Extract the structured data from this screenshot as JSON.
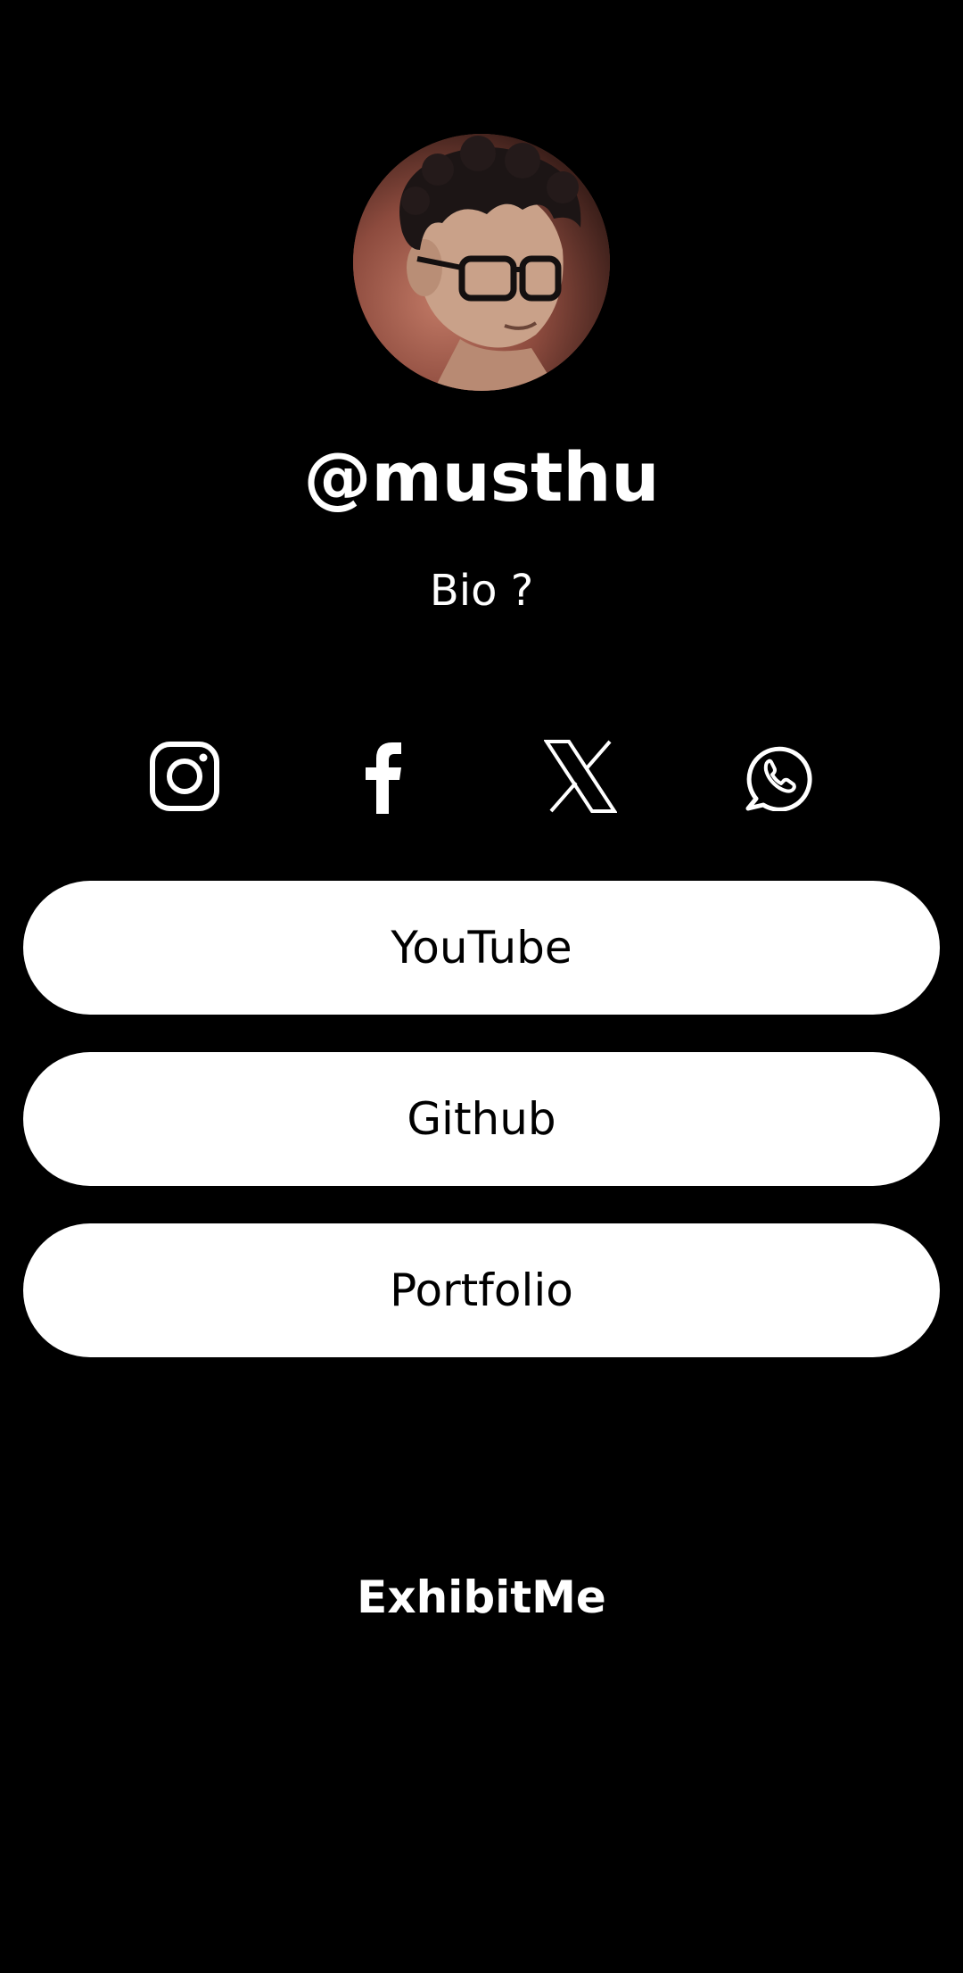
{
  "profile": {
    "username": "@musthu",
    "bio": "Bio ?"
  },
  "socials": [
    {
      "icon": "instagram-icon"
    },
    {
      "icon": "facebook-icon"
    },
    {
      "icon": "x-icon"
    },
    {
      "icon": "whatsapp-icon"
    }
  ],
  "links": [
    {
      "label": "YouTube"
    },
    {
      "label": "Github"
    },
    {
      "label": "Portfolio"
    }
  ],
  "footer": {
    "brand": "ExhibitMe"
  },
  "colors": {
    "background": "#000000",
    "foreground": "#ffffff",
    "button_bg": "#ffffff",
    "button_text": "#000000"
  }
}
